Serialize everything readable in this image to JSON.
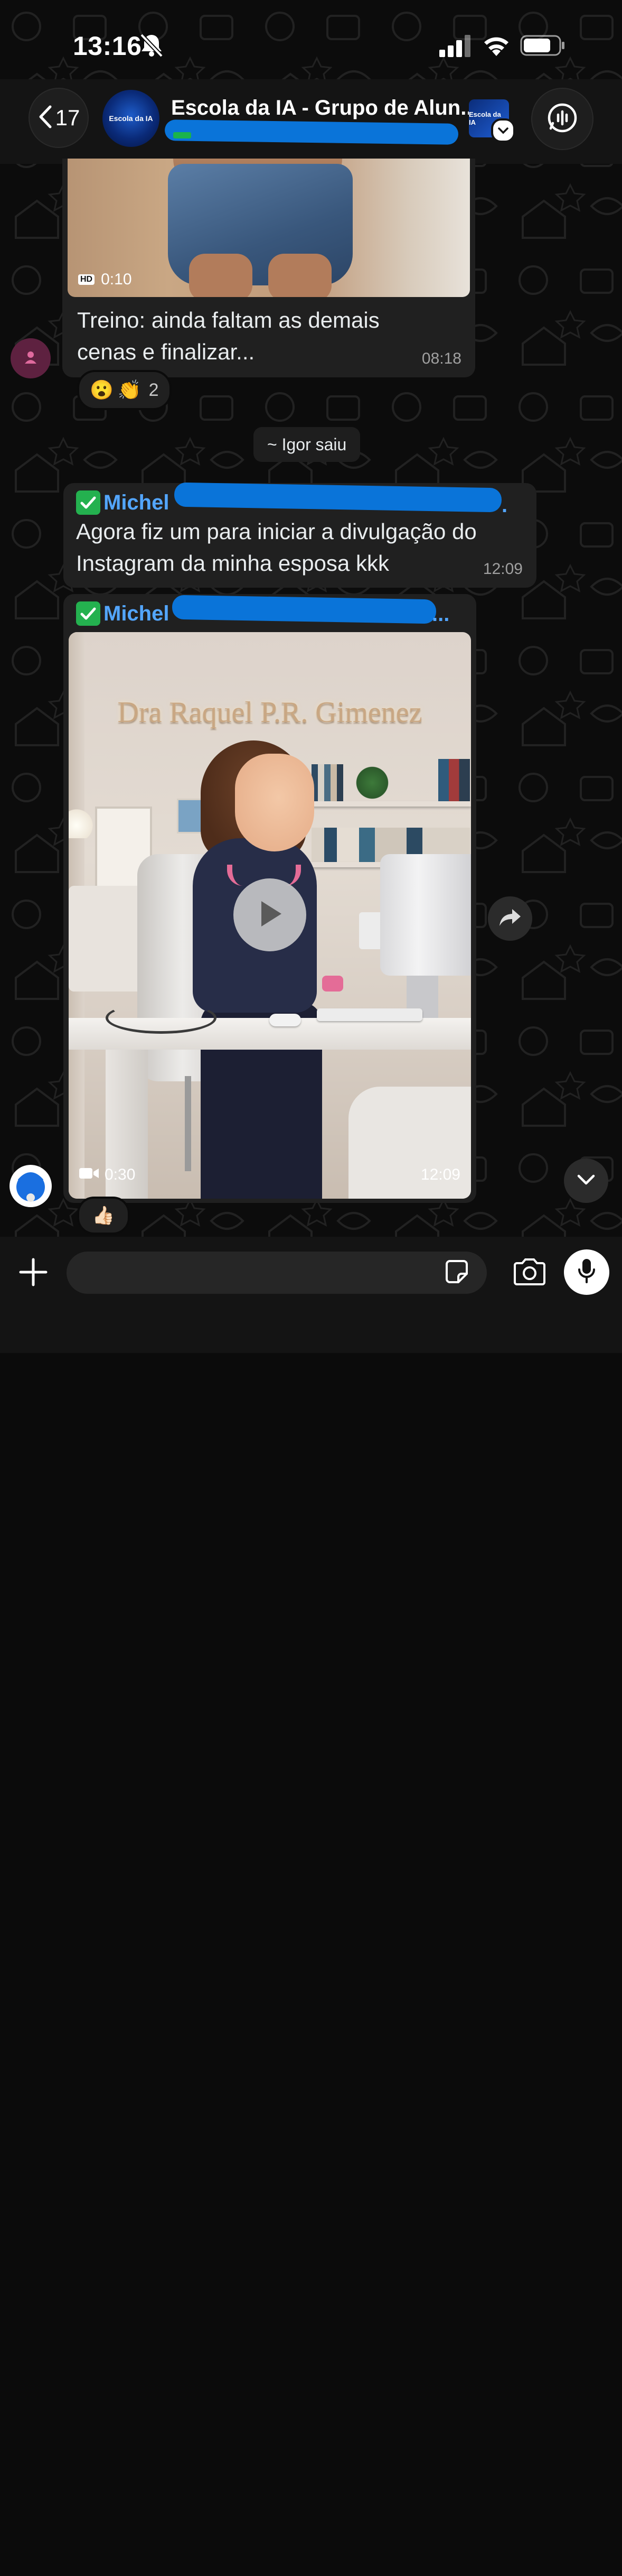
{
  "status_bar": {
    "time": "13:16"
  },
  "header": {
    "back_count": "17",
    "title": "Escola da IA - Grupo de Alun...",
    "avatar_label": "Escola da IA",
    "avatar_sub": "",
    "mini_avatar_label": "Escola da IA"
  },
  "messages": [
    {
      "video_duration": "0:10",
      "video_quality": "HD",
      "text": "Treino: ainda faltam as demais cenas e finalizar...",
      "time": "08:18",
      "reactions": [
        "😮",
        "👏"
      ],
      "reaction_count": "2"
    },
    {
      "system": "~ Igor saiu"
    },
    {
      "sender": "Michel",
      "sender_suffix": ".",
      "text": "Agora fiz um para iniciar a divulgação do Instagram da minha esposa kkk",
      "time": "12:09"
    },
    {
      "sender": "Michel",
      "sender_suffix": "...",
      "video_sign": "Dra Raquel P.R. Gimenez",
      "video_duration": "0:30",
      "time": "12:09",
      "reaction": "👍🏻"
    }
  ],
  "input": {
    "placeholder": ""
  },
  "colors": {
    "background": "#0b0b0b",
    "bubble": "#202020",
    "sender": "#53a6ff",
    "redaction": "#0a74d9",
    "verified_check": "#24b14f"
  },
  "icons": [
    "bell-slash-icon",
    "signal-icon",
    "wifi-icon",
    "battery-icon",
    "chevron-left-icon",
    "chevron-down-icon",
    "voice-call-icon",
    "person-icon",
    "play-icon",
    "video-camera-icon",
    "forward-icon",
    "plus-icon",
    "sticker-icon",
    "camera-icon",
    "microphone-icon"
  ]
}
